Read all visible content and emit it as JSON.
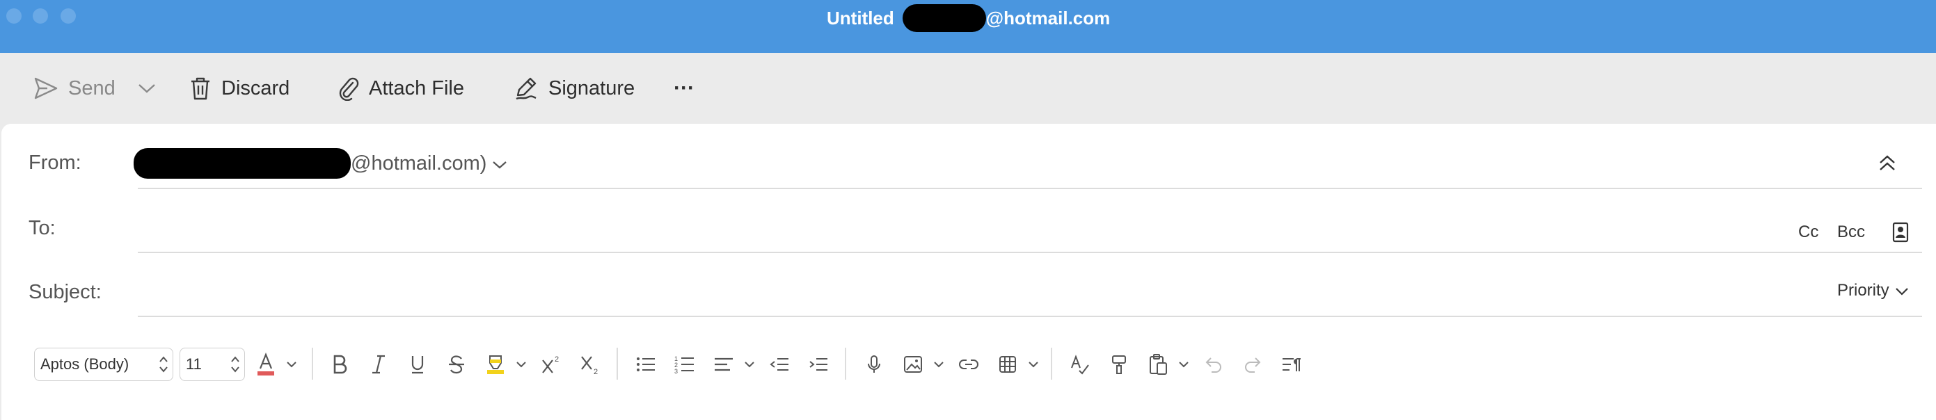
{
  "window": {
    "title_prefix": "Untitled",
    "title_suffix": "@hotmail.com",
    "title_accent_color": "#4a96df"
  },
  "toolbar": {
    "send_label": "Send",
    "discard_label": "Discard",
    "attach_label": "Attach File",
    "signature_label": "Signature",
    "more_label": "···"
  },
  "compose": {
    "from_label": "From:",
    "from_value_suffix": "@hotmail.com)",
    "to_label": "To:",
    "to_value": "",
    "cc_label": "Cc",
    "bcc_label": "Bcc",
    "subject_label": "Subject:",
    "subject_value": "",
    "priority_label": "Priority"
  },
  "format_bar": {
    "font_family": "Aptos (Body)",
    "font_size": "11",
    "font_color": "#e05a5a",
    "highlight_color": "#f2d21b",
    "tools": [
      "bold-icon",
      "italic-icon",
      "underline-icon",
      "strikethrough-icon",
      "highlight-icon",
      "superscript-icon",
      "subscript-icon",
      "bullet-list-icon",
      "numbered-list-icon",
      "align-icon",
      "decrease-indent-icon",
      "increase-indent-icon",
      "dictate-icon",
      "picture-icon",
      "link-icon",
      "table-icon",
      "editor-icon",
      "format-painter-icon",
      "paste-icon",
      "undo-icon",
      "redo-icon",
      "show-formatting-icon"
    ]
  }
}
